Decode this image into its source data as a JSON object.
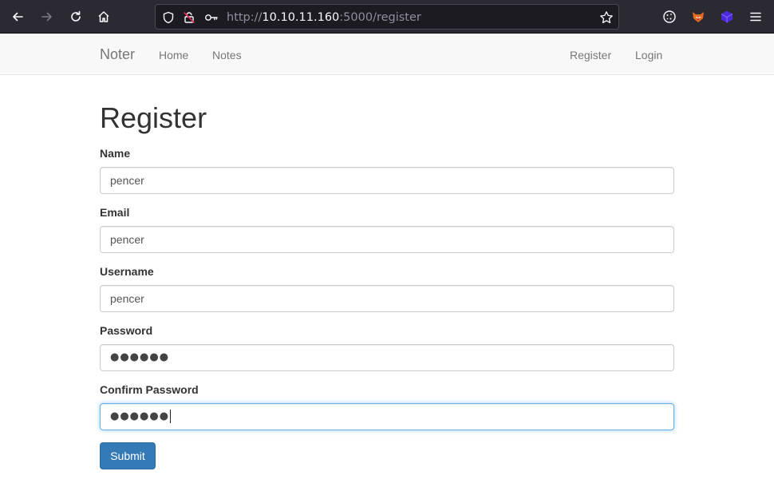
{
  "browser": {
    "url_scheme": "http://",
    "url_host": "10.10.11.160",
    "url_rest": ":5000/register"
  },
  "navbar": {
    "brand": "Noter",
    "left_links": [
      "Home",
      "Notes"
    ],
    "right_links": [
      "Register",
      "Login"
    ]
  },
  "page": {
    "title": "Register",
    "fields": [
      {
        "label": "Name",
        "value": "pencer",
        "type": "text"
      },
      {
        "label": "Email",
        "value": "pencer",
        "type": "text"
      },
      {
        "label": "Username",
        "value": "pencer",
        "type": "text"
      },
      {
        "label": "Password",
        "value": "●●●●●●",
        "type": "password"
      },
      {
        "label": "Confirm Password",
        "value": "●●●●●●",
        "type": "password",
        "focused": true
      }
    ],
    "submit_label": "Submit"
  },
  "colors": {
    "primary": "#337ab7",
    "focus_border": "#66afe9",
    "chrome_bg": "#2b2a33",
    "navbar_bg": "#f8f8f8"
  }
}
